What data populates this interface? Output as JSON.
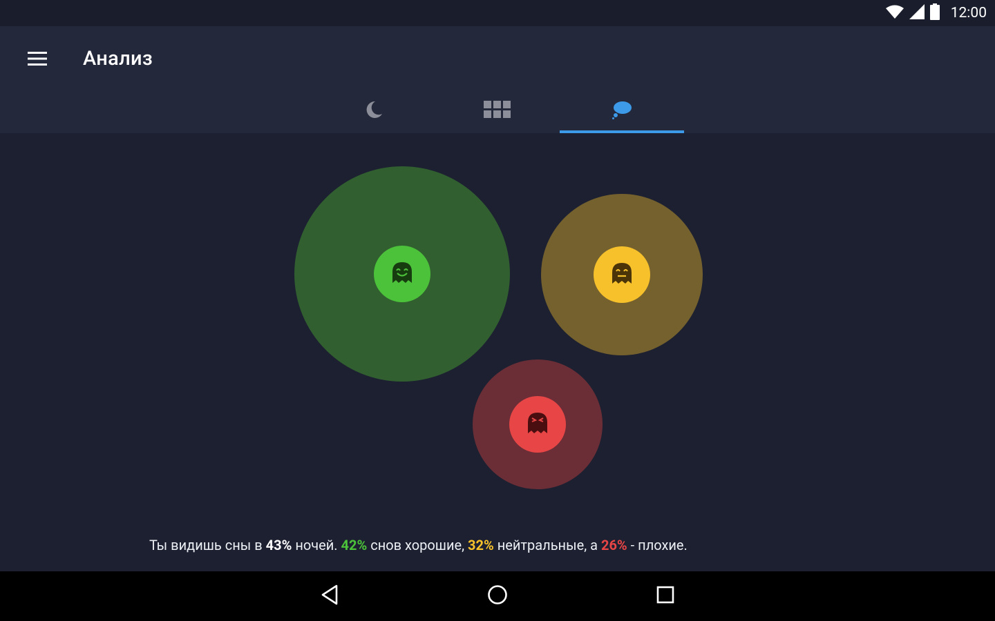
{
  "status_bar": {
    "time": "12:00",
    "icons": [
      "wifi-icon",
      "signal-icon",
      "battery-icon"
    ]
  },
  "app_bar": {
    "title": "Анализ",
    "menu_icon": "hamburger-menu-icon"
  },
  "tabs": [
    {
      "icon": "moon-icon",
      "active": false
    },
    {
      "icon": "grid-icon",
      "active": false
    },
    {
      "icon": "dream-cloud-icon",
      "active": true
    }
  ],
  "colors": {
    "accent": "#3d9ae8",
    "good": "#4cc23a",
    "neutral": "#f7c12b",
    "bad": "#e84646",
    "good_halo": "#315f30",
    "neutral_halo": "#75612e",
    "bad_halo": "#6b2e36"
  },
  "dream_bubbles": [
    {
      "type": "good",
      "percent": 42,
      "icon": "happy-ghost-icon"
    },
    {
      "type": "neutral",
      "percent": 32,
      "icon": "neutral-ghost-icon"
    },
    {
      "type": "bad",
      "percent": 26,
      "icon": "angry-ghost-icon"
    }
  ],
  "summary": {
    "part1": "Ты видишь сны в ",
    "nights_percent": "43%",
    "part2": " ночей. ",
    "good_percent": "42%",
    "part3": " снов хорошие, ",
    "neutral_percent": "32%",
    "part4": " нейтральные, а ",
    "bad_percent": "26%",
    "part5": " - плохие."
  },
  "nav_bar": {
    "buttons": [
      "back-icon",
      "home-icon",
      "recents-icon"
    ]
  }
}
